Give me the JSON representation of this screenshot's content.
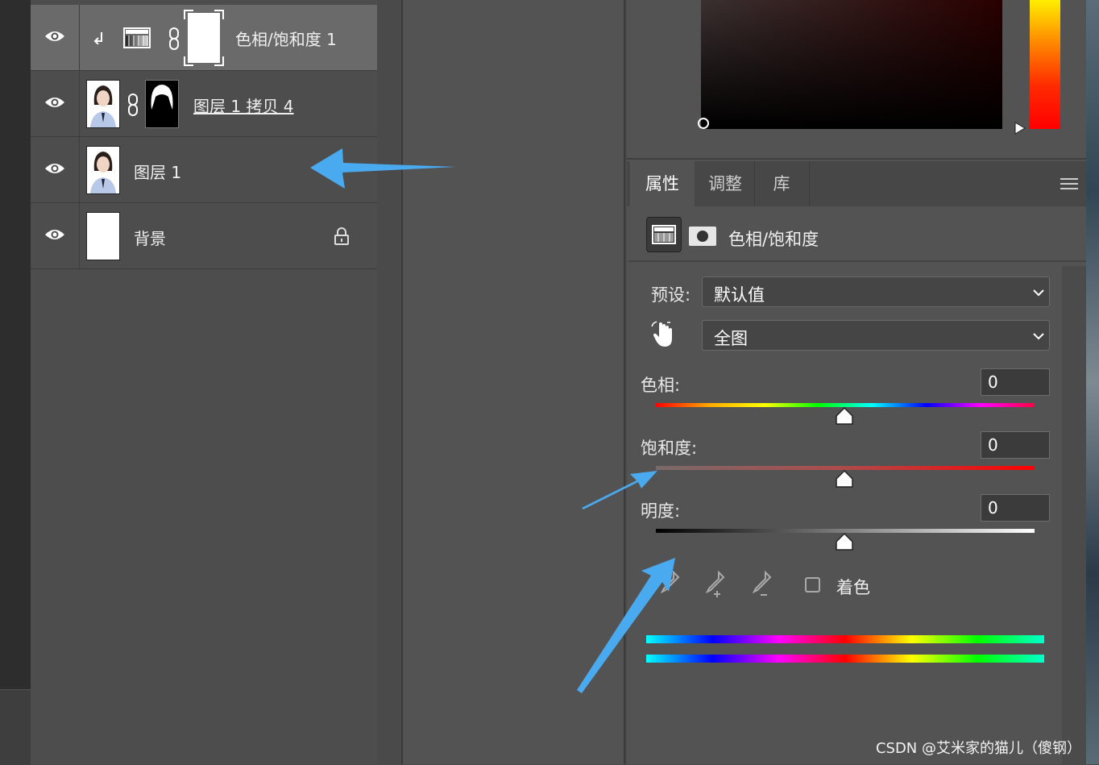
{
  "layers": [
    {
      "name": "色相/饱和度 1",
      "type": "adjustment",
      "selected": true
    },
    {
      "name": "图层 1 拷贝 4",
      "type": "photo-with-mask",
      "selected": false
    },
    {
      "name": "图层 1",
      "type": "photo",
      "selected": false
    },
    {
      "name": "背景",
      "type": "background",
      "locked": true,
      "selected": false
    }
  ],
  "panel_tabs": [
    "属性",
    "调整",
    "库"
  ],
  "properties": {
    "title": "色相/饱和度",
    "preset_label": "预设:",
    "preset_value": "默认值",
    "channel_value": "全图",
    "hue_label": "色相:",
    "hue_value": "0",
    "saturation_label": "饱和度:",
    "saturation_value": "0",
    "lightness_label": "明度:",
    "lightness_value": "0",
    "colorize_label": "着色"
  },
  "watermark": "CSDN @艾米家的猫儿（傻钢）",
  "colors": {
    "arrow": "#4aaaf0",
    "panel_bg": "#535353",
    "selected_row": "#6a6a6a"
  }
}
